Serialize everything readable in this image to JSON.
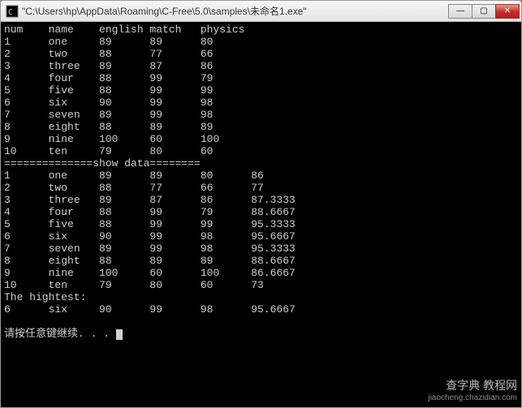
{
  "window": {
    "title": "\"C:\\Users\\hp\\AppData\\Roaming\\C-Free\\5.0\\samples\\未命名1.exe\"",
    "icon_name": "app-icon"
  },
  "titlebar_buttons": {
    "minimize": "—",
    "maximize": "▢",
    "close": "✕"
  },
  "headers": {
    "num": "num",
    "name": "name",
    "english": "english",
    "match": "match",
    "physics": "physics"
  },
  "rows1": [
    {
      "num": "1",
      "name": "one",
      "english": "89",
      "match": "89",
      "physics": "80"
    },
    {
      "num": "2",
      "name": "two",
      "english": "88",
      "match": "77",
      "physics": "66"
    },
    {
      "num": "3",
      "name": "three",
      "english": "89",
      "match": "87",
      "physics": "86"
    },
    {
      "num": "4",
      "name": "four",
      "english": "88",
      "match": "99",
      "physics": "79"
    },
    {
      "num": "5",
      "name": "five",
      "english": "88",
      "match": "99",
      "physics": "99"
    },
    {
      "num": "6",
      "name": "six",
      "english": "90",
      "match": "99",
      "physics": "98"
    },
    {
      "num": "7",
      "name": "seven",
      "english": "89",
      "match": "99",
      "physics": "98"
    },
    {
      "num": "8",
      "name": "eight",
      "english": "88",
      "match": "89",
      "physics": "89"
    },
    {
      "num": "9",
      "name": "nine",
      "english": "100",
      "match": "60",
      "physics": "100"
    },
    {
      "num": "10",
      "name": "ten",
      "english": "79",
      "match": "80",
      "physics": "60"
    }
  ],
  "separator": "==============show data========",
  "rows2": [
    {
      "num": "1",
      "name": "one",
      "english": "89",
      "match": "89",
      "c5": "80",
      "c6": "86"
    },
    {
      "num": "2",
      "name": "two",
      "english": "88",
      "match": "77",
      "c5": "66",
      "c6": "77"
    },
    {
      "num": "3",
      "name": "three",
      "english": "89",
      "match": "87",
      "c5": "86",
      "c6": "87.3333"
    },
    {
      "num": "4",
      "name": "four",
      "english": "88",
      "match": "99",
      "c5": "79",
      "c6": "88.6667"
    },
    {
      "num": "5",
      "name": "five",
      "english": "88",
      "match": "99",
      "c5": "99",
      "c6": "95.3333"
    },
    {
      "num": "6",
      "name": "six",
      "english": "90",
      "match": "99",
      "c5": "98",
      "c6": "95.6667"
    },
    {
      "num": "7",
      "name": "seven",
      "english": "89",
      "match": "99",
      "c5": "98",
      "c6": "95.3333"
    },
    {
      "num": "8",
      "name": "eight",
      "english": "88",
      "match": "89",
      "c5": "89",
      "c6": "88.6667"
    },
    {
      "num": "9",
      "name": "nine",
      "english": "100",
      "match": "60",
      "c5": "100",
      "c6": "86.6667"
    },
    {
      "num": "10",
      "name": "ten",
      "english": "79",
      "match": "80",
      "c5": "60",
      "c6": "73"
    }
  ],
  "highest_label": "The hightest:",
  "highest": {
    "num": "6",
    "name": "six",
    "english": "90",
    "match": "99",
    "c5": "98",
    "c6": "95.6667"
  },
  "prompt": "请按任意键继续. . . ",
  "watermark": {
    "brand": "查字典 教程网",
    "url": "jiaocheng.chazidian.com"
  }
}
